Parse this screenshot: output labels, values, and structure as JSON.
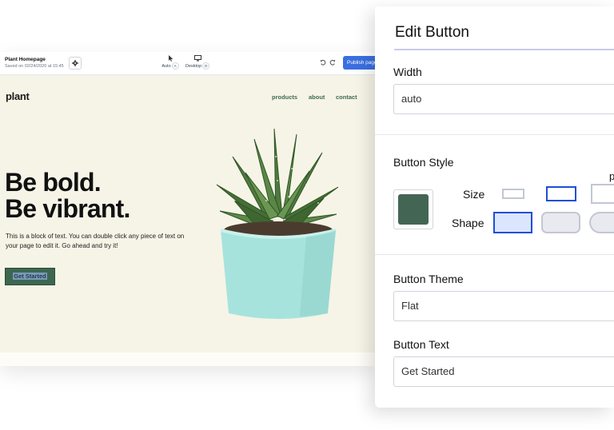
{
  "builder": {
    "page_title": "Plant Homepage",
    "saved_text": "Saved on 02/24/2020 at 15:45",
    "modes": [
      {
        "label": "Auto",
        "key": "A",
        "icon": "cursor-icon"
      },
      {
        "label": "Desktop",
        "key": "D",
        "icon": "monitor-icon"
      }
    ],
    "publish_label": "Publish page"
  },
  "site": {
    "logo": "plant",
    "nav": [
      "products",
      "about",
      "contact"
    ],
    "headline_line1": "Be bold.",
    "headline_line2": "Be vibrant.",
    "paragraph": "This is a block of text. You can double click any piece of text on your page to edit it. Go ahead and try it!",
    "cta_label": "Get Started",
    "accent_color": "#3d6751"
  },
  "panel": {
    "title": "Edit Button",
    "width_label": "Width",
    "width_value": "auto",
    "style_label": "Button Style",
    "size_label": "Size",
    "shape_label": "Shape",
    "cut_label": "p",
    "swatch_color": "#436654",
    "selected_size": "medium",
    "selected_shape": "square",
    "theme_label": "Button Theme",
    "theme_value": "Flat",
    "text_label": "Button Text",
    "text_value": "Get Started",
    "selection_color": "#1d4ed8"
  }
}
